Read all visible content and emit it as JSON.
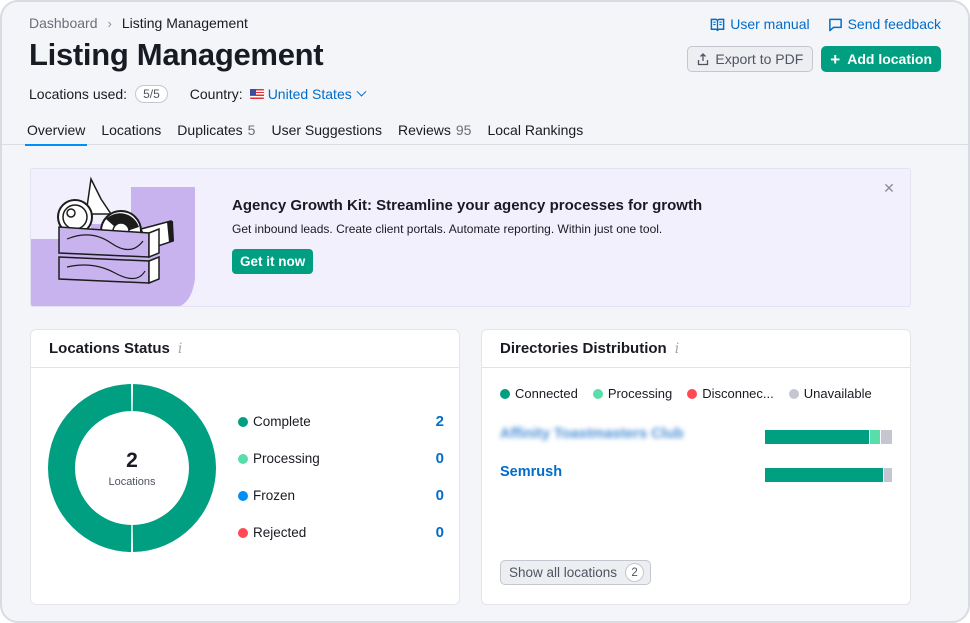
{
  "breadcrumb": {
    "root": "Dashboard",
    "current": "Listing Management"
  },
  "header": {
    "title": "Listing Management",
    "locations_used_label": "Locations used:",
    "locations_used_value": "5/5",
    "country_label": "Country:",
    "country_value": "United States",
    "country_flag_icon": "us-flag-icon"
  },
  "top_links": {
    "user_manual": "User manual",
    "send_feedback": "Send feedback"
  },
  "actions": {
    "export_label": "Export to PDF",
    "add_label": "Add location"
  },
  "tabs": [
    {
      "label": "Overview",
      "count": "",
      "active": true
    },
    {
      "label": "Locations",
      "count": ""
    },
    {
      "label": "Duplicates",
      "count": "5"
    },
    {
      "label": "User Suggestions",
      "count": ""
    },
    {
      "label": "Reviews",
      "count": "95"
    },
    {
      "label": "Local Rankings",
      "count": ""
    }
  ],
  "banner": {
    "title": "Agency Growth Kit: Streamline your agency processes for growth",
    "subtitle": "Get inbound leads. Create client portals. Automate reporting. Within just one tool.",
    "button": "Get it now",
    "close_icon": "close-icon"
  },
  "status_card": {
    "title": "Locations Status",
    "total": "2",
    "total_label": "Locations",
    "items": [
      {
        "label": "Complete",
        "value": "2",
        "color": "#009f81"
      },
      {
        "label": "Processing",
        "value": "0",
        "color": "#59ddaa"
      },
      {
        "label": "Frozen",
        "value": "0",
        "color": "#008ff8"
      },
      {
        "label": "Rejected",
        "value": "0",
        "color": "#ff4953"
      }
    ]
  },
  "dist_card": {
    "title": "Directories Distribution",
    "legend": [
      {
        "label": "Connected",
        "color": "#009f81"
      },
      {
        "label": "Processing",
        "color": "#59ddaa"
      },
      {
        "label": "Disconnec...",
        "color": "#ff4953"
      },
      {
        "label": "Unavailable",
        "color": "#c4c7cf"
      }
    ],
    "rows": [
      {
        "name": "Affinity Toastmasters Club",
        "blurred": true,
        "connected_pct": 83,
        "processing_pct": 8,
        "disconnected_pct": 0,
        "unavailable_pct": 9
      },
      {
        "name": "Semrush",
        "blurred": false,
        "connected_pct": 94,
        "processing_pct": 0,
        "disconnected_pct": 0,
        "unavailable_pct": 6
      }
    ],
    "show_all_label": "Show all locations",
    "show_all_count": "2"
  },
  "colors": {
    "accent": "#009f81",
    "link": "#006dca",
    "tab_indicator": "#008ff8",
    "banner_bg": "#f3f0fd",
    "banner_art": "#c8b3ef"
  }
}
